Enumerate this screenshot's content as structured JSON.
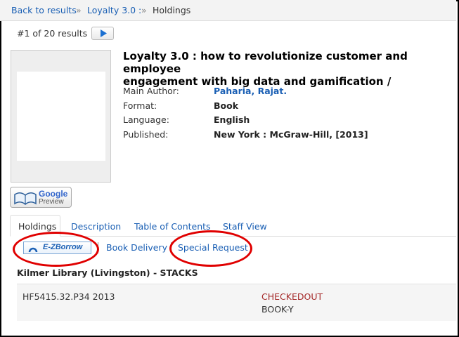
{
  "breadcrumb": {
    "back": "Back to results",
    "sep": "»",
    "title": "Loyalty 3.0 :",
    "current": "Holdings"
  },
  "pager": {
    "text": "#1 of 20 results"
  },
  "google_preview": {
    "google": "Google",
    "preview": "Preview"
  },
  "record": {
    "title_line1": "Loyalty 3.0 : how to revolutionize customer and employee",
    "title_line2": "engagement with big data and gamification /",
    "fields": [
      {
        "label": "Main Author:",
        "value": "Paharia, Rajat."
      },
      {
        "label": "Format:",
        "value": "Book"
      },
      {
        "label": "Language:",
        "value": "English"
      },
      {
        "label": "Published:",
        "value": "New York : McGraw-Hill, [2013]"
      }
    ]
  },
  "tabs": [
    "Holdings",
    "Description",
    "Table of Contents",
    "Staff View"
  ],
  "actions": {
    "ezborrow": "E-ZBorrow",
    "book_delivery": "Book Delivery",
    "special_request": "Special Request"
  },
  "holdings": {
    "location": "Kilmer Library (Livingston) - STACKS",
    "call_number": "HF5415.32.P34 2013",
    "status": "CHECKEDOUT",
    "item_type": "BOOK-Y"
  },
  "colors": {
    "link": "#1a5fb4",
    "status": "#a52a2a",
    "highlight": "#e00000"
  }
}
